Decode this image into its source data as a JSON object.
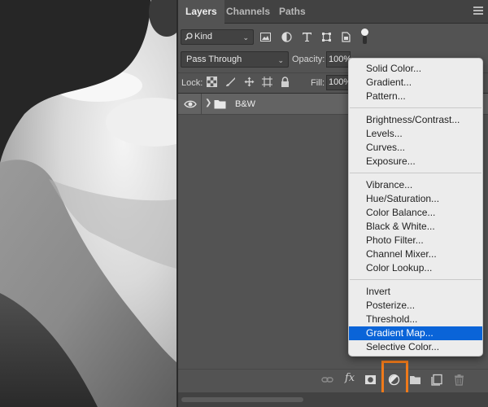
{
  "tabs": [
    {
      "label": "Layers",
      "active": true
    },
    {
      "label": "Channels",
      "active": false
    },
    {
      "label": "Paths",
      "active": false
    }
  ],
  "filter": {
    "kind_label": "Kind"
  },
  "blend": {
    "mode": "Pass Through",
    "opacity_label": "Opacity:",
    "opacity_value": "100%"
  },
  "lock": {
    "label": "Lock:",
    "fill_label": "Fill:",
    "fill_value": "100%"
  },
  "layers": [
    {
      "name": "B&W",
      "type": "group",
      "visible": true,
      "expanded": false
    }
  ],
  "adjustment_menu": {
    "groups": [
      [
        "Solid Color...",
        "Gradient...",
        "Pattern..."
      ],
      [
        "Brightness/Contrast...",
        "Levels...",
        "Curves...",
        "Exposure..."
      ],
      [
        "Vibrance...",
        "Hue/Saturation...",
        "Color Balance...",
        "Black & White...",
        "Photo Filter...",
        "Channel Mixer...",
        "Color Lookup..."
      ],
      [
        "Invert",
        "Posterize...",
        "Threshold...",
        "Gradient Map...",
        "Selective Color..."
      ]
    ],
    "selected": "Gradient Map..."
  },
  "bottom_bar": {
    "fx_label": "fx",
    "icons": [
      "link-icon",
      "fx-icon",
      "mask-icon",
      "adjustment-layer-icon",
      "folder-icon",
      "new-layer-icon",
      "trash-icon"
    ],
    "highlighted": "adjustment-layer-icon"
  },
  "colors": {
    "panel_bg": "#535353",
    "tab_bar_bg": "#424242",
    "menu_bg": "#ececec",
    "menu_selected": "#0a64d8",
    "highlight_box": "#f07a1a"
  }
}
